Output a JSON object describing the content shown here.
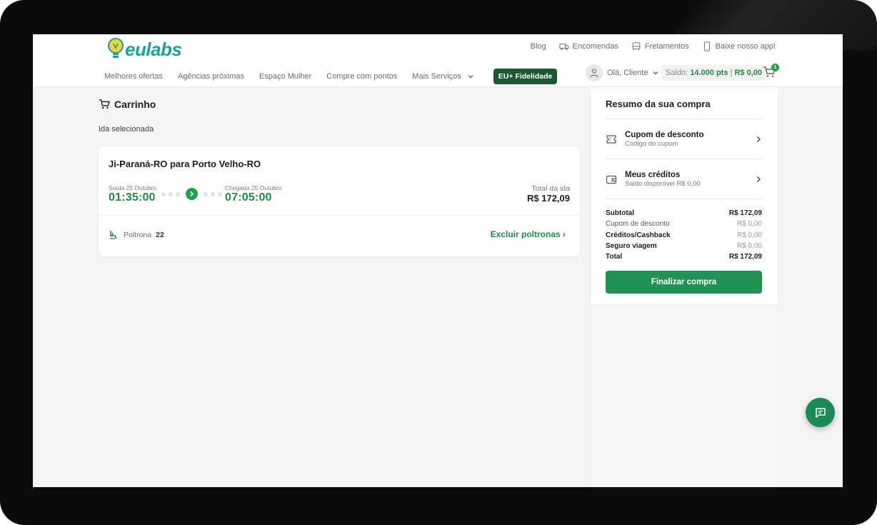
{
  "brand": {
    "logo_text": "eulabs",
    "accent": "#1aa39a",
    "primary_green": "#1e8a48"
  },
  "header": {
    "top_links": [
      {
        "label": "Blog",
        "icon": ""
      },
      {
        "label": "Encomendas",
        "icon": "truck-icon"
      },
      {
        "label": "Fretamentos",
        "icon": "bus-icon"
      },
      {
        "label": "Baixe nosso app!",
        "icon": "phone-icon"
      }
    ],
    "nav": [
      "Melhores ofertas",
      "Agências próximas",
      "Espaço Mulher",
      "Compre com pontos",
      "Mais Serviços"
    ],
    "fidelidade_label": "EU+ Fidelidade",
    "user_greeting": "Olá, Cliente",
    "saldo_label": "Saldo:",
    "saldo_pts": "14.000 pts",
    "saldo_sep": "|",
    "saldo_money": "R$ 0,00",
    "cart_count": "1"
  },
  "main": {
    "title": "Carrinho",
    "subtitle": "Ida selecionada",
    "trip": {
      "route": "Ji-Paraná-RO para Porto Velho-RO",
      "departure_label": "Saída 25 Outubro",
      "departure_time": "01:35:00",
      "arrival_label": "Chegada 25 Outubro",
      "arrival_time": "07:05:00",
      "total_label": "Total da ida",
      "total_value": "R$ 172,09",
      "seat_label": "Poltrona",
      "seat_number": "22",
      "remove_label": "Excluir poltronas ›"
    }
  },
  "summary": {
    "title": "Resumo da sua compra",
    "coupon_title": "Cupom de desconto",
    "coupon_sub": "Código do cupom",
    "credits_title": "Meus créditos",
    "credits_sub": "Saldo disponível R$ 0,00",
    "rows": [
      {
        "label": "Subtotal",
        "value": "R$ 172,09"
      },
      {
        "label": "Cupom de desconto",
        "value": "R$ 0,00"
      },
      {
        "label": "Créditos/Cashback",
        "value": "R$ 0,00"
      },
      {
        "label": "Seguro viagem",
        "value": "R$ 0,00"
      },
      {
        "label": "Total",
        "value": "R$ 172,09"
      }
    ],
    "button_label": "Finalizar compra"
  }
}
